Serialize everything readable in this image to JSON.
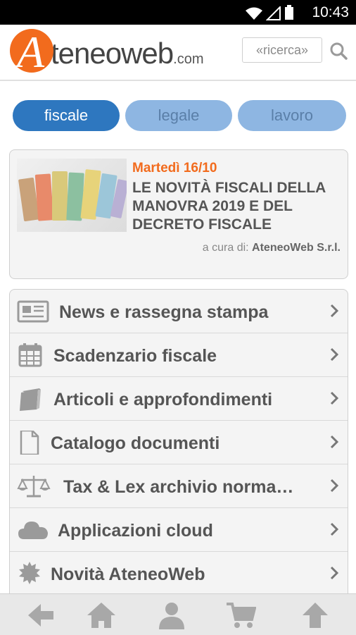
{
  "status_bar": {
    "time": "10:43"
  },
  "header": {
    "logo_letter": "A",
    "logo_word": "teneoweb",
    "logo_com": ".com",
    "search_placeholder": "«ricerca»"
  },
  "tabs": [
    {
      "label": "fiscale",
      "active": true
    },
    {
      "label": "legale",
      "active": false
    },
    {
      "label": "lavoro",
      "active": false
    }
  ],
  "news": {
    "date": "Martedì 16/10",
    "title": "LE NOVITÀ FISCALI DELLA MANOVRA 2019 E DEL DECRETO FISCALE",
    "credit_prefix": "a cura di:",
    "credit_author": "AteneoWeb S.r.l."
  },
  "menu": [
    {
      "label": "News e rassegna stampa",
      "icon": "newspaper-icon"
    },
    {
      "label": "Scadenzario fiscale",
      "icon": "calendar-icon"
    },
    {
      "label": "Articoli e approfondimenti",
      "icon": "book-icon"
    },
    {
      "label": "Catalogo documenti",
      "icon": "document-icon"
    },
    {
      "label": "Tax & Lex archivio norma…",
      "icon": "scales-icon"
    },
    {
      "label": "Applicazioni cloud",
      "icon": "cloud-icon"
    },
    {
      "label": "Novità AteneoWeb",
      "icon": "starburst-icon"
    }
  ],
  "bottom_nav": [
    "back-arrow-icon",
    "home-icon",
    "user-icon",
    "cart-icon",
    "up-arrow-icon"
  ],
  "colors": {
    "accent_orange": "#f26b1d",
    "tab_active": "#2e77bf",
    "tab_inactive": "#8eb6e2"
  }
}
